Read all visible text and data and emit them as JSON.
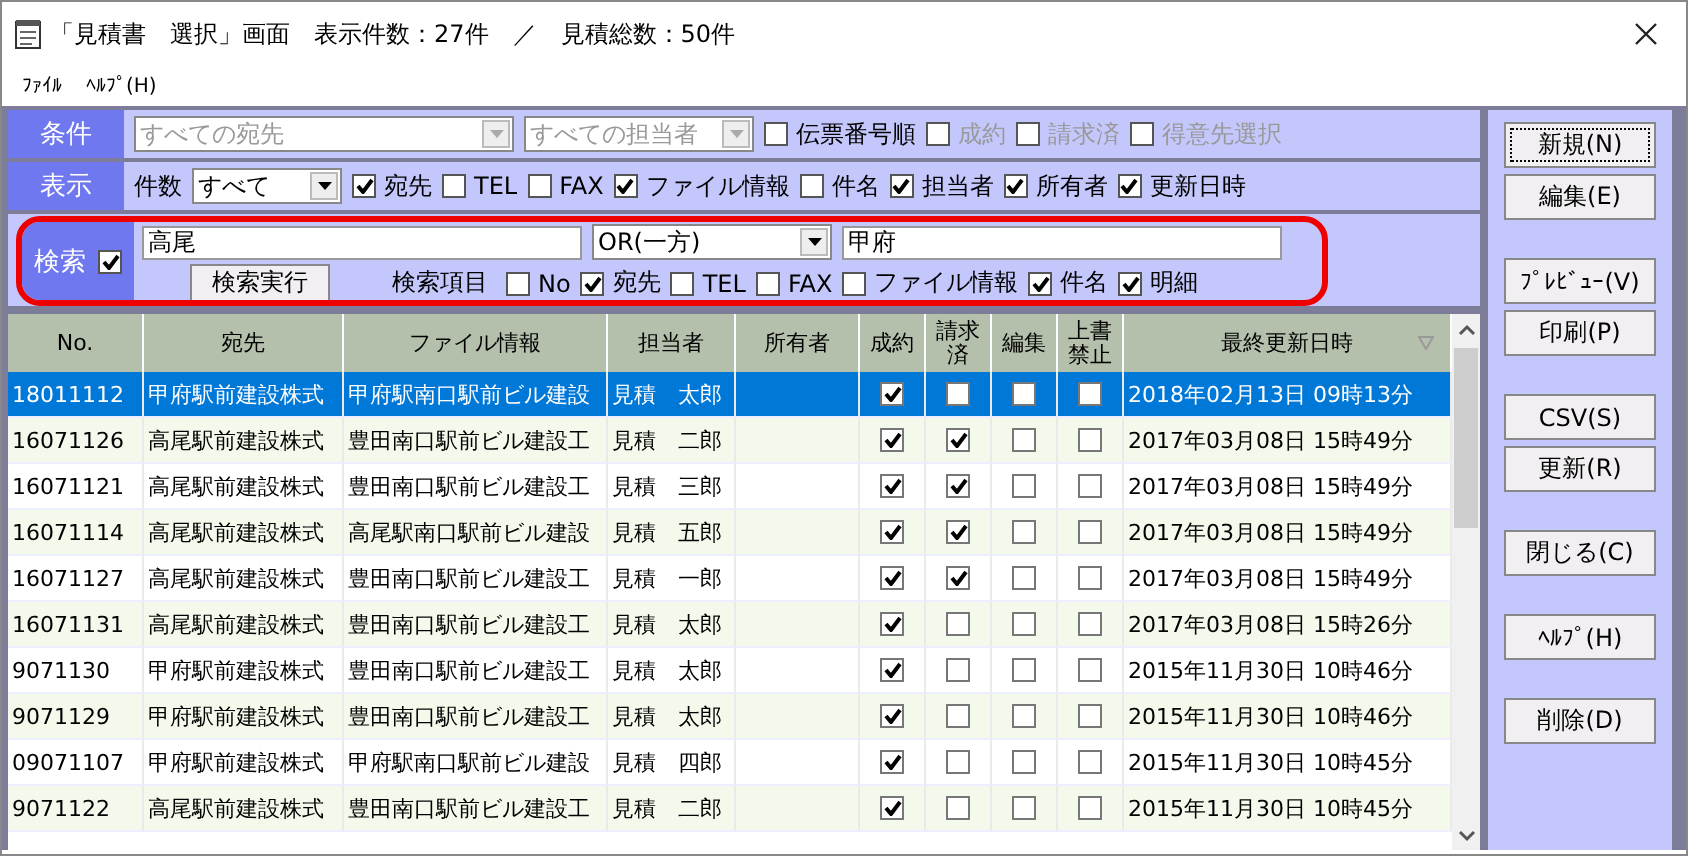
{
  "window": {
    "title": "「見積書　選択」画面",
    "shown_count": "表示件数：27件",
    "separator": "／",
    "total_count": "見積総数：50件"
  },
  "menu": [
    "ﾌｧｲﾙ",
    "ﾍﾙﾌﾟ(H)"
  ],
  "conditions": {
    "label": "条件",
    "dropdowns": [
      {
        "value": "すべての宛先",
        "disabled": true
      },
      {
        "value": "すべての担当者",
        "disabled": true
      }
    ],
    "checkboxes": [
      {
        "label": "伝票番号順",
        "checked": false,
        "disabled": false
      },
      {
        "label": "成約",
        "checked": false,
        "disabled": true
      },
      {
        "label": "請求済",
        "checked": false,
        "disabled": true
      },
      {
        "label": "得意先選択",
        "checked": false,
        "disabled": true
      }
    ]
  },
  "display": {
    "label": "表示",
    "count_label": "件数",
    "count_value": "すべて",
    "checkboxes": [
      {
        "label": "宛先",
        "checked": true
      },
      {
        "label": "TEL",
        "checked": false
      },
      {
        "label": "FAX",
        "checked": false
      },
      {
        "label": "ファイル情報",
        "checked": true
      },
      {
        "label": "件名",
        "checked": false
      },
      {
        "label": "担当者",
        "checked": true
      },
      {
        "label": "所有者",
        "checked": true
      },
      {
        "label": "更新日時",
        "checked": true
      }
    ]
  },
  "search": {
    "label": "検索",
    "checked": true,
    "keyword1": "高尾",
    "operator": "OR(一方)",
    "keyword2": "甲府",
    "run_button": "検索実行",
    "items_label": "検索項目",
    "checkboxes": [
      {
        "label": "No",
        "checked": false
      },
      {
        "label": "宛先",
        "checked": true
      },
      {
        "label": "TEL",
        "checked": false
      },
      {
        "label": "FAX",
        "checked": false
      },
      {
        "label": "ファイル情報",
        "checked": false
      },
      {
        "label": "件名",
        "checked": true
      },
      {
        "label": "明細",
        "checked": true
      }
    ]
  },
  "table": {
    "columns": [
      "No.",
      "宛先",
      "ファイル情報",
      "担当者",
      "所有者",
      "成約",
      "請求済",
      "編集",
      "上書禁止",
      "最終更新日時"
    ],
    "rows": [
      {
        "no": "18011112",
        "dest": "甲府駅前建設株式",
        "file": "甲府駅南口駅前ビル建設",
        "person": "見積　太郎",
        "contracted": true,
        "billed": false,
        "edit": false,
        "locked": false,
        "updated": "2018年02月13日 09時13分",
        "selected": true
      },
      {
        "no": "16071126",
        "dest": "高尾駅前建設株式",
        "file": "豊田南口駅前ビル建設工",
        "person": "見積　二郎",
        "contracted": true,
        "billed": true,
        "edit": false,
        "locked": false,
        "updated": "2017年03月08日 15時49分",
        "selected": false
      },
      {
        "no": "16071121",
        "dest": "高尾駅前建設株式",
        "file": "豊田南口駅前ビル建設工",
        "person": "見積　三郎",
        "contracted": true,
        "billed": true,
        "edit": false,
        "locked": false,
        "updated": "2017年03月08日 15時49分",
        "selected": false
      },
      {
        "no": "16071114",
        "dest": "高尾駅前建設株式",
        "file": "高尾駅南口駅前ビル建設",
        "person": "見積　五郎",
        "contracted": true,
        "billed": true,
        "edit": false,
        "locked": false,
        "updated": "2017年03月08日 15時49分",
        "selected": false
      },
      {
        "no": "16071127",
        "dest": "高尾駅前建設株式",
        "file": "豊田南口駅前ビル建設工",
        "person": "見積　一郎",
        "contracted": true,
        "billed": true,
        "edit": false,
        "locked": false,
        "updated": "2017年03月08日 15時49分",
        "selected": false
      },
      {
        "no": "16071131",
        "dest": "高尾駅前建設株式",
        "file": "豊田南口駅前ビル建設工",
        "person": "見積　太郎",
        "contracted": true,
        "billed": false,
        "edit": false,
        "locked": false,
        "updated": "2017年03月08日 15時26分",
        "selected": false
      },
      {
        "no": "9071130",
        "dest": "甲府駅前建設株式",
        "file": "豊田南口駅前ビル建設工",
        "person": "見積　太郎",
        "contracted": true,
        "billed": false,
        "edit": false,
        "locked": false,
        "updated": "2015年11月30日 10時46分",
        "selected": false
      },
      {
        "no": "9071129",
        "dest": "甲府駅前建設株式",
        "file": "豊田南口駅前ビル建設工",
        "person": "見積　太郎",
        "contracted": true,
        "billed": false,
        "edit": false,
        "locked": false,
        "updated": "2015年11月30日 10時46分",
        "selected": false
      },
      {
        "no": "09071107",
        "dest": "甲府駅前建設株式",
        "file": "甲府駅南口駅前ビル建設",
        "person": "見積　四郎",
        "contracted": true,
        "billed": false,
        "edit": false,
        "locked": false,
        "updated": "2015年11月30日 10時45分",
        "selected": false
      },
      {
        "no": "9071122",
        "dest": "高尾駅前建設株式",
        "file": "豊田南口駅前ビル建設工",
        "person": "見積　二郎",
        "contracted": true,
        "billed": false,
        "edit": false,
        "locked": false,
        "updated": "2015年11月30日 10時45分",
        "selected": false
      }
    ]
  },
  "button_groups": [
    [
      {
        "label": "新規(N)",
        "focused": true
      },
      {
        "label": "編集(E)",
        "focused": false
      }
    ],
    [
      {
        "label": "ﾌﾟﾚﾋﾞｭｰ(V)",
        "focused": false
      },
      {
        "label": "印刷(P)",
        "focused": false
      }
    ],
    [
      {
        "label": "CSV(S)",
        "focused": false
      },
      {
        "label": "更新(R)",
        "focused": false
      }
    ],
    [
      {
        "label": "閉じる(C)",
        "focused": false
      }
    ],
    [
      {
        "label": "ﾍﾙﾌﾟ(H)",
        "focused": false
      }
    ],
    [
      {
        "label": "削除(D)",
        "focused": false
      }
    ]
  ]
}
